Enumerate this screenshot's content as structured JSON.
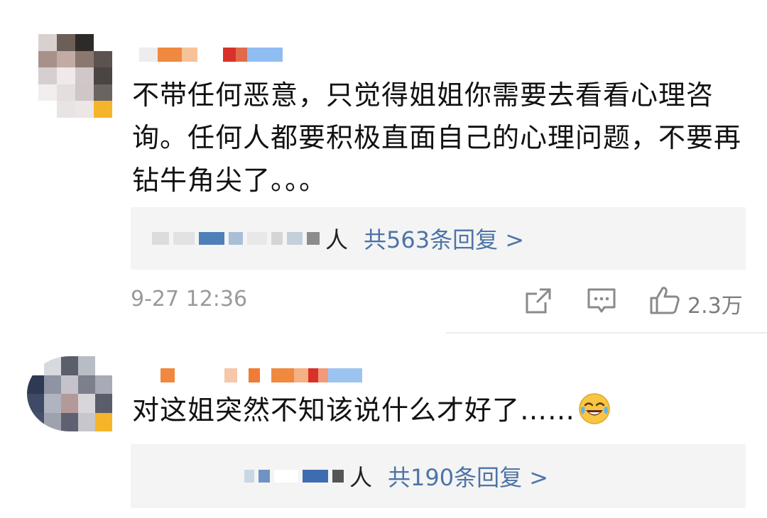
{
  "comments": [
    {
      "text": "不带任何恶意，只觉得姐姐你需要去看看心理咨询。任何人都要积极直面自己的心理问题，不要再钻牛角尖了。。。",
      "reply_suffix": "人",
      "reply_link": "共563条回复 >",
      "timestamp": "9-27 12:36",
      "like_count": "2.3万",
      "share_icon": "share-icon",
      "comment_icon": "comment-icon",
      "like_icon": "thumbs-up-icon"
    },
    {
      "text": "对这姐突然不知该说什么才好了……",
      "emoji": "laughing-crying-emoji",
      "reply_suffix": "人",
      "reply_link": "共190条回复 >"
    }
  ],
  "colors": {
    "link": "#4d74a6",
    "reply_bg": "#f4f4f4",
    "meta_text": "#9a9a9a"
  }
}
